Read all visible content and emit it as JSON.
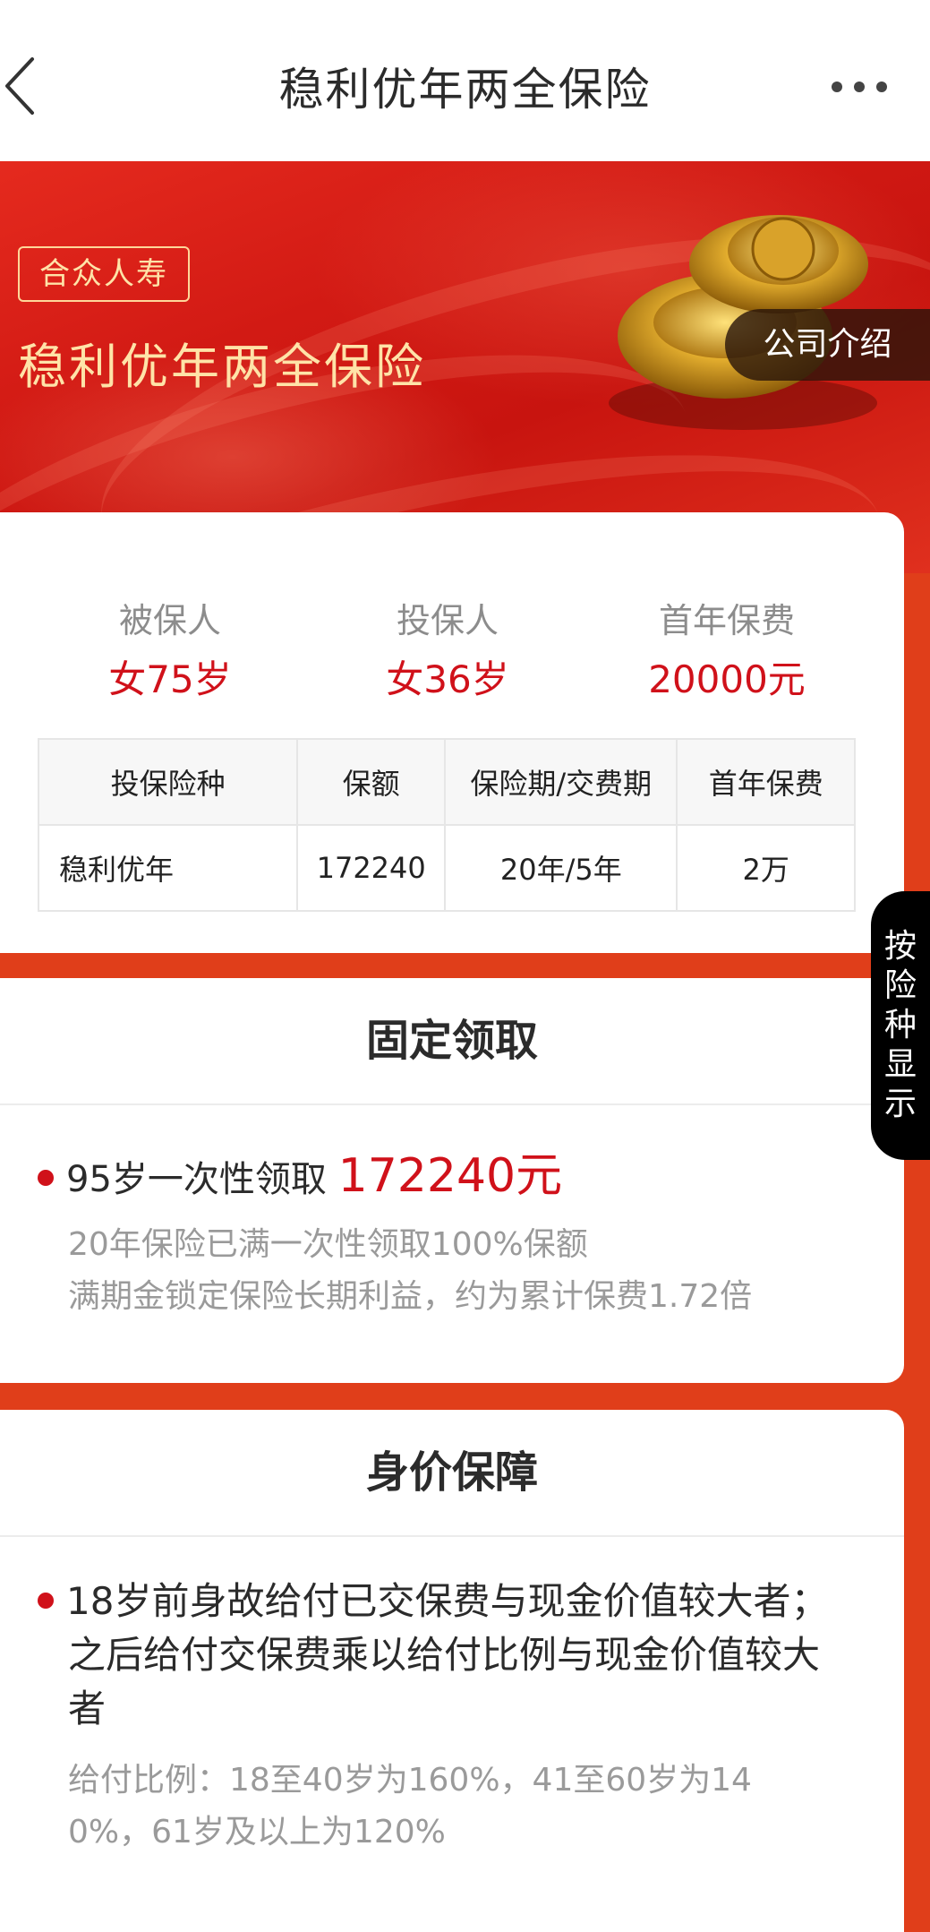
{
  "nav": {
    "title": "稳利优年两全保险",
    "back_icon": "chevron-left-icon",
    "more_icon": "more-horizontal-icon"
  },
  "banner": {
    "brand": "合众人寿",
    "title": "稳利优年两全保险",
    "company_intro": "公司介绍",
    "image": "gold-ingot-icon"
  },
  "summary": {
    "insured_label": "被保人",
    "insured_value": "女75岁",
    "holder_label": "投保人",
    "holder_value": "女36岁",
    "premium_label": "首年保费",
    "premium_value": "20000元"
  },
  "table": {
    "headers": [
      "投保险种",
      "保额",
      "保险期/交费期",
      "首年保费"
    ],
    "rows": [
      [
        "稳利优年",
        "172240",
        "20年/5年",
        "2万"
      ]
    ]
  },
  "fixed_payout": {
    "title": "固定领取",
    "bullet_text": "95岁一次性领取",
    "bullet_amount": "172240元",
    "note1": "20年保险已满一次性领取100%保额",
    "note2": "满期金锁定保险长期利益，约为累计保费1.72倍"
  },
  "life_protection": {
    "title": "身价保障",
    "line1": "18岁前身故给付已交保费与现金价值较大者；",
    "line2": "之后给付交保费乘以给付比例与现金价值较大",
    "line3": "者",
    "note1": "给付比例：18至40岁为160%，41至60岁为14",
    "note2": "0%，61岁及以上为120%"
  },
  "side_tab": {
    "chars": [
      "按",
      "险",
      "种",
      "显",
      "示"
    ]
  },
  "colors": {
    "accent_red": "#d0111a",
    "banner_red": "#d21a14",
    "background_red": "#e03e1a",
    "gold_text": "#ffe3a8"
  }
}
